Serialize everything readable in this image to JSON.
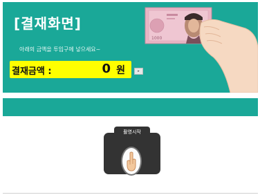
{
  "header": {
    "title": "[결재화면]",
    "instruction": "아래의 금액을 투입구에 넣으세요~"
  },
  "payment": {
    "label": "결재금액 :",
    "amount": "0",
    "unit": "원"
  },
  "small_button": {
    "icon": "button-icon",
    "label": "▸"
  },
  "capture": {
    "label": "촬영시작",
    "icon": "hand-pointer-icon"
  },
  "colors": {
    "accent": "#1aa898",
    "highlight": "#ffff00",
    "camera": "#333333"
  }
}
